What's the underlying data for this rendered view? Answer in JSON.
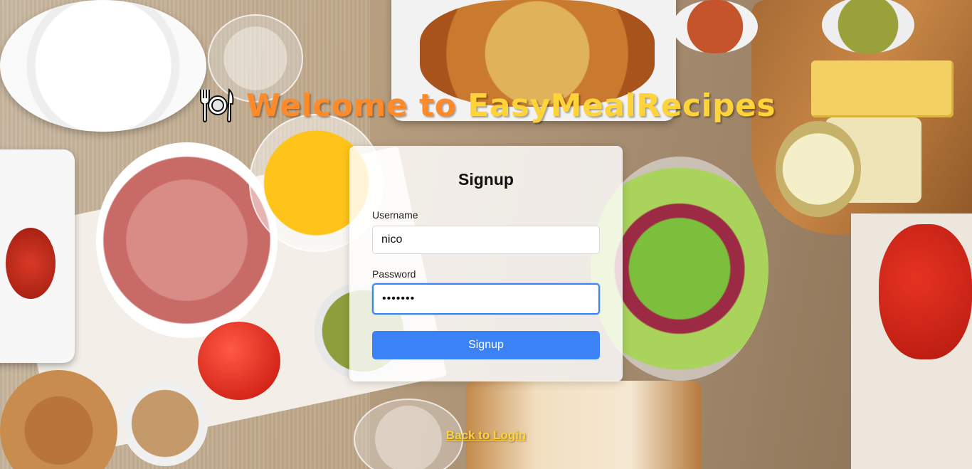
{
  "header": {
    "title_part1": "Welcome to",
    "title_part2": "EasyMealRecipes",
    "icon": "plate-cutlery-icon"
  },
  "form": {
    "heading": "Signup",
    "username_label": "Username",
    "username_value": "nico",
    "password_label": "Password",
    "password_value": "•••••••",
    "submit_label": "Signup"
  },
  "footer": {
    "back_link": "Back to Login"
  },
  "colors": {
    "accent_blue": "#3b82f6",
    "title_orange": "#ff8a2a",
    "title_yellow": "#ffd43a"
  }
}
